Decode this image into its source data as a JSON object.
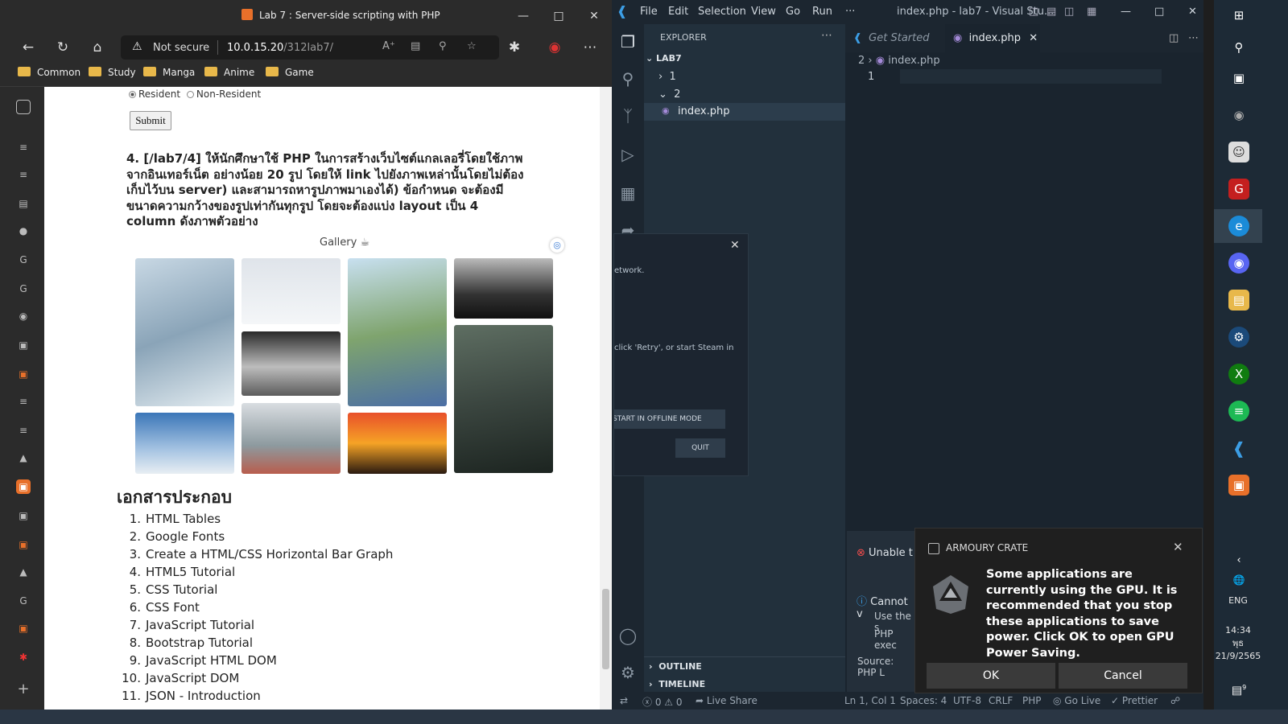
{
  "browser": {
    "title": "Lab 7 : Server-side scripting with PHP",
    "security": "Not secure",
    "url_host": "10.0.15.20",
    "url_path": "/312lab7/",
    "bookmarks": [
      "Common",
      "Study",
      "Manga",
      "Anime",
      "Game"
    ],
    "colors": {
      "chrome": "#2b2b2b",
      "folder": "#e8b84a"
    }
  },
  "page": {
    "radio_resident": "Resident",
    "radio_nonresident": "Non-Resident",
    "submit_label": "Submit",
    "task_text": "4. [/lab7/4] ให้นักศึกษาใช้ PHP ในการสร้างเว็บไซต์แกลเลอรี่โดยใช้ภาพจากอินเทอร์เน็ต อย่างน้อย 20 รูป โดยให้ link ไปยังภาพเหล่านั้นโดยไม่ต้องเก็บไว้บน server) และสามารถหารูปภาพมาเองได้) ข้อกำหนด จะต้องมีขนาดความกว้างของรูปเท่ากันทุกรูป โดยจะต้องแบ่ง layout เป็น 4 column ดังภาพตัวอย่าง",
    "gallery_title": "Gallery",
    "docs_heading": "เอกสารประกอบ",
    "docs": [
      "HTML Tables",
      "Google Fonts",
      "Create a HTML/CSS Horizontal Bar Graph",
      "HTML5 Tutorial",
      "CSS Tutorial",
      "CSS Font",
      "JavaScript Tutorial",
      "Bootstrap Tutorial",
      "JavaScript HTML DOM",
      "JavaScript DOM",
      "JSON - Introduction"
    ]
  },
  "vscode": {
    "menu": [
      "File",
      "Edit",
      "Selection",
      "View",
      "Go",
      "Run",
      "···"
    ],
    "title": "index.php - lab7 - Visual Stu...",
    "explorer_label": "EXPLORER",
    "folder": "LAB7",
    "tree": [
      "1",
      "2",
      "index.php"
    ],
    "tabs": [
      "Get Started",
      "index.php"
    ],
    "breadcrumb": [
      "2",
      "index.php"
    ],
    "line_number": "1",
    "outline": "OUTLINE",
    "timeline": "TIMELINE",
    "notif_error": "Unable t",
    "notif_info": "Cannot v",
    "notif_use": "Use the s",
    "notif_php": "PHP exec",
    "notif_source": "Source: PHP L",
    "status": {
      "problems": "0",
      "warnings": "0",
      "live_share": "Live Share",
      "position": "Ln 1, Col 1",
      "spaces": "Spaces: 4",
      "encoding": "UTF-8",
      "eol": "CRLF",
      "language": "PHP",
      "go_live": "Go Live",
      "prettier": "Prettier"
    }
  },
  "steam": {
    "text1": "etwork.",
    "text2": "click 'Retry', or start Steam in",
    "offline_button": "START IN OFFLINE MODE",
    "quit_button": "QUIT"
  },
  "armoury": {
    "app_name": "ARMOURY CRATE",
    "message": "Some applications are currently using the GPU. It is recommended that you stop these applications to save power. Click OK to open GPU Power Saving.",
    "ok": "OK",
    "cancel": "Cancel"
  },
  "taskbar": {
    "lang": "ENG",
    "time": "14:34",
    "day": "พุธ",
    "date": "21/9/2565",
    "notif_count": "9"
  }
}
